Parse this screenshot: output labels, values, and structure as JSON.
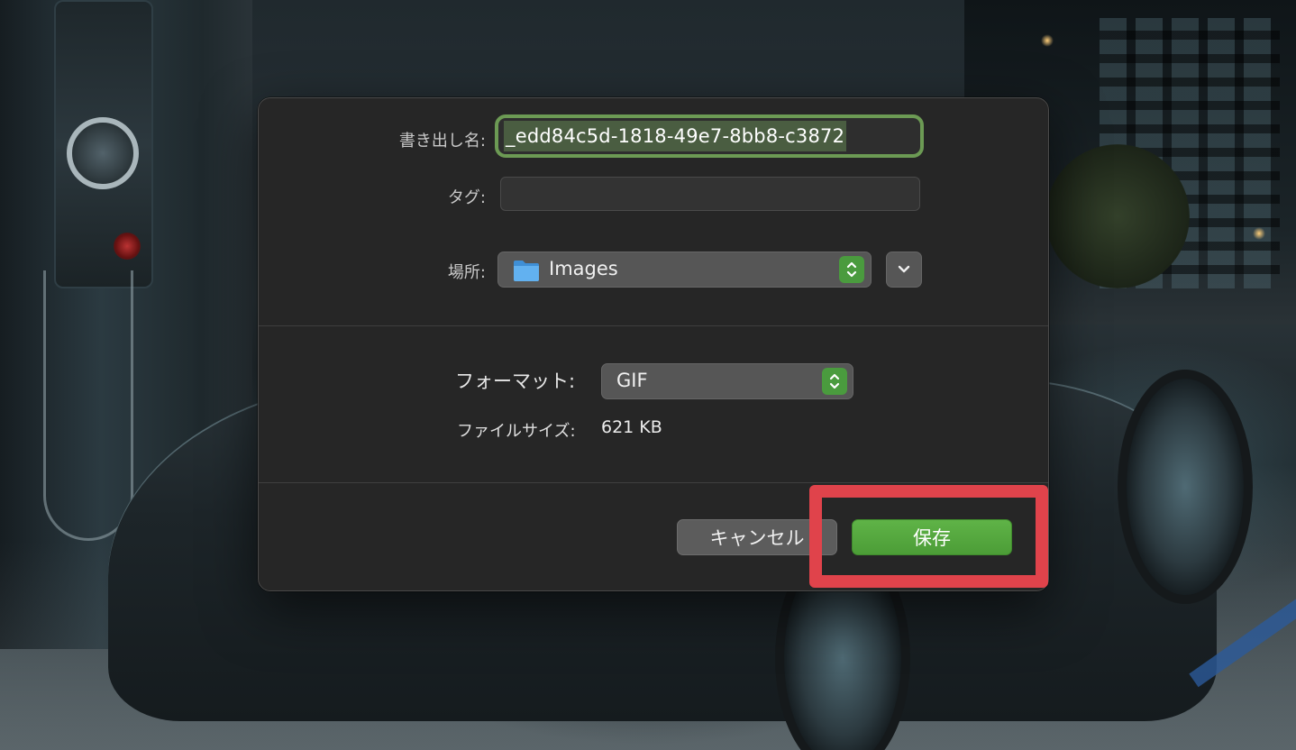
{
  "dialog": {
    "export_name_label": "書き出し名:",
    "export_name_value": "_edd84c5d-1818-49e7-8bb8-c3872",
    "tag_label": "タグ:",
    "tag_value": "",
    "location_label": "場所:",
    "location_value": "Images",
    "format_label": "フォーマット:",
    "format_value": "GIF",
    "filesize_label": "ファイルサイズ:",
    "filesize_value": "621 KB",
    "cancel_label": "キャンセル",
    "save_label": "保存"
  },
  "colors": {
    "name_field_border": "#6c9a54",
    "stepper_accent": "#4a9b3e",
    "save_button": "#52a43c",
    "highlight": "#e0434b"
  },
  "icons": [
    "folder-icon",
    "chevron-updown-icon",
    "chevron-down-icon"
  ]
}
